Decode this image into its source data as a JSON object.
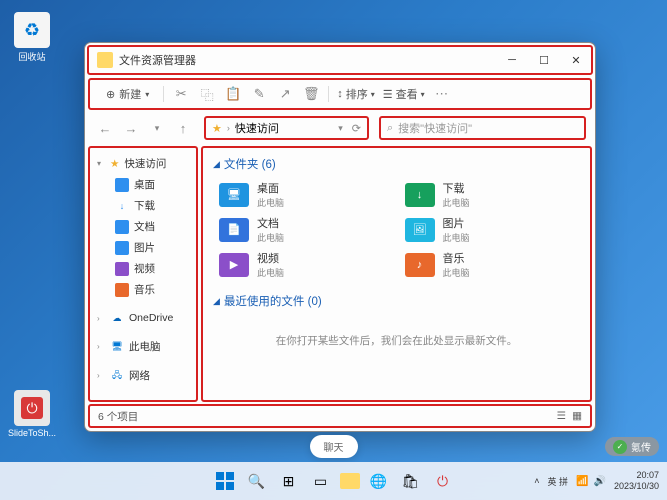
{
  "desktop": {
    "recycle_bin": "回收站",
    "slide_app": "SlideToSh..."
  },
  "window": {
    "title": "文件资源管理器",
    "toolbar": {
      "new": "新建",
      "sort": "排序",
      "view": "查看"
    },
    "breadcrumb": {
      "location": "快速访问"
    },
    "search": {
      "placeholder": "搜索\"快速访问\""
    }
  },
  "sidebar": {
    "quick_access": "快速访问",
    "items": [
      {
        "label": "桌面",
        "color": "#2e8fef"
      },
      {
        "label": "下载",
        "color": "#2e8fef"
      },
      {
        "label": "文档",
        "color": "#2e8fef"
      },
      {
        "label": "图片",
        "color": "#2e8fef"
      },
      {
        "label": "视频",
        "color": "#8b4fc9"
      },
      {
        "label": "音乐",
        "color": "#e8682c"
      }
    ],
    "onedrive": "OneDrive",
    "this_pc": "此电脑",
    "network": "网络"
  },
  "main": {
    "folders_header": "文件夹 (6)",
    "folders": [
      {
        "name": "桌面",
        "loc": "此电脑",
        "color": "#1f94e0",
        "glyph": "🖥"
      },
      {
        "name": "下载",
        "loc": "此电脑",
        "color": "#16a05d",
        "glyph": "↓"
      },
      {
        "name": "文档",
        "loc": "此电脑",
        "color": "#3273dc",
        "glyph": "📄"
      },
      {
        "name": "图片",
        "loc": "此电脑",
        "color": "#1fb6e0",
        "glyph": "🖼"
      },
      {
        "name": "视频",
        "loc": "此电脑",
        "color": "#8b4fc9",
        "glyph": "▶"
      },
      {
        "name": "音乐",
        "loc": "此电脑",
        "color": "#e8682c",
        "glyph": "♪"
      }
    ],
    "recent_header": "最近使用的文件 (0)",
    "recent_empty": "在你打开某些文件后，我们会在此处显示最新文件。"
  },
  "statusbar": {
    "count": "6 个项目"
  },
  "search_pill": "聊天",
  "taskbar": {
    "ime": "英",
    "ime2": "拼",
    "time": "20:07",
    "date": "2023/10/30"
  },
  "watermark": "氪传"
}
